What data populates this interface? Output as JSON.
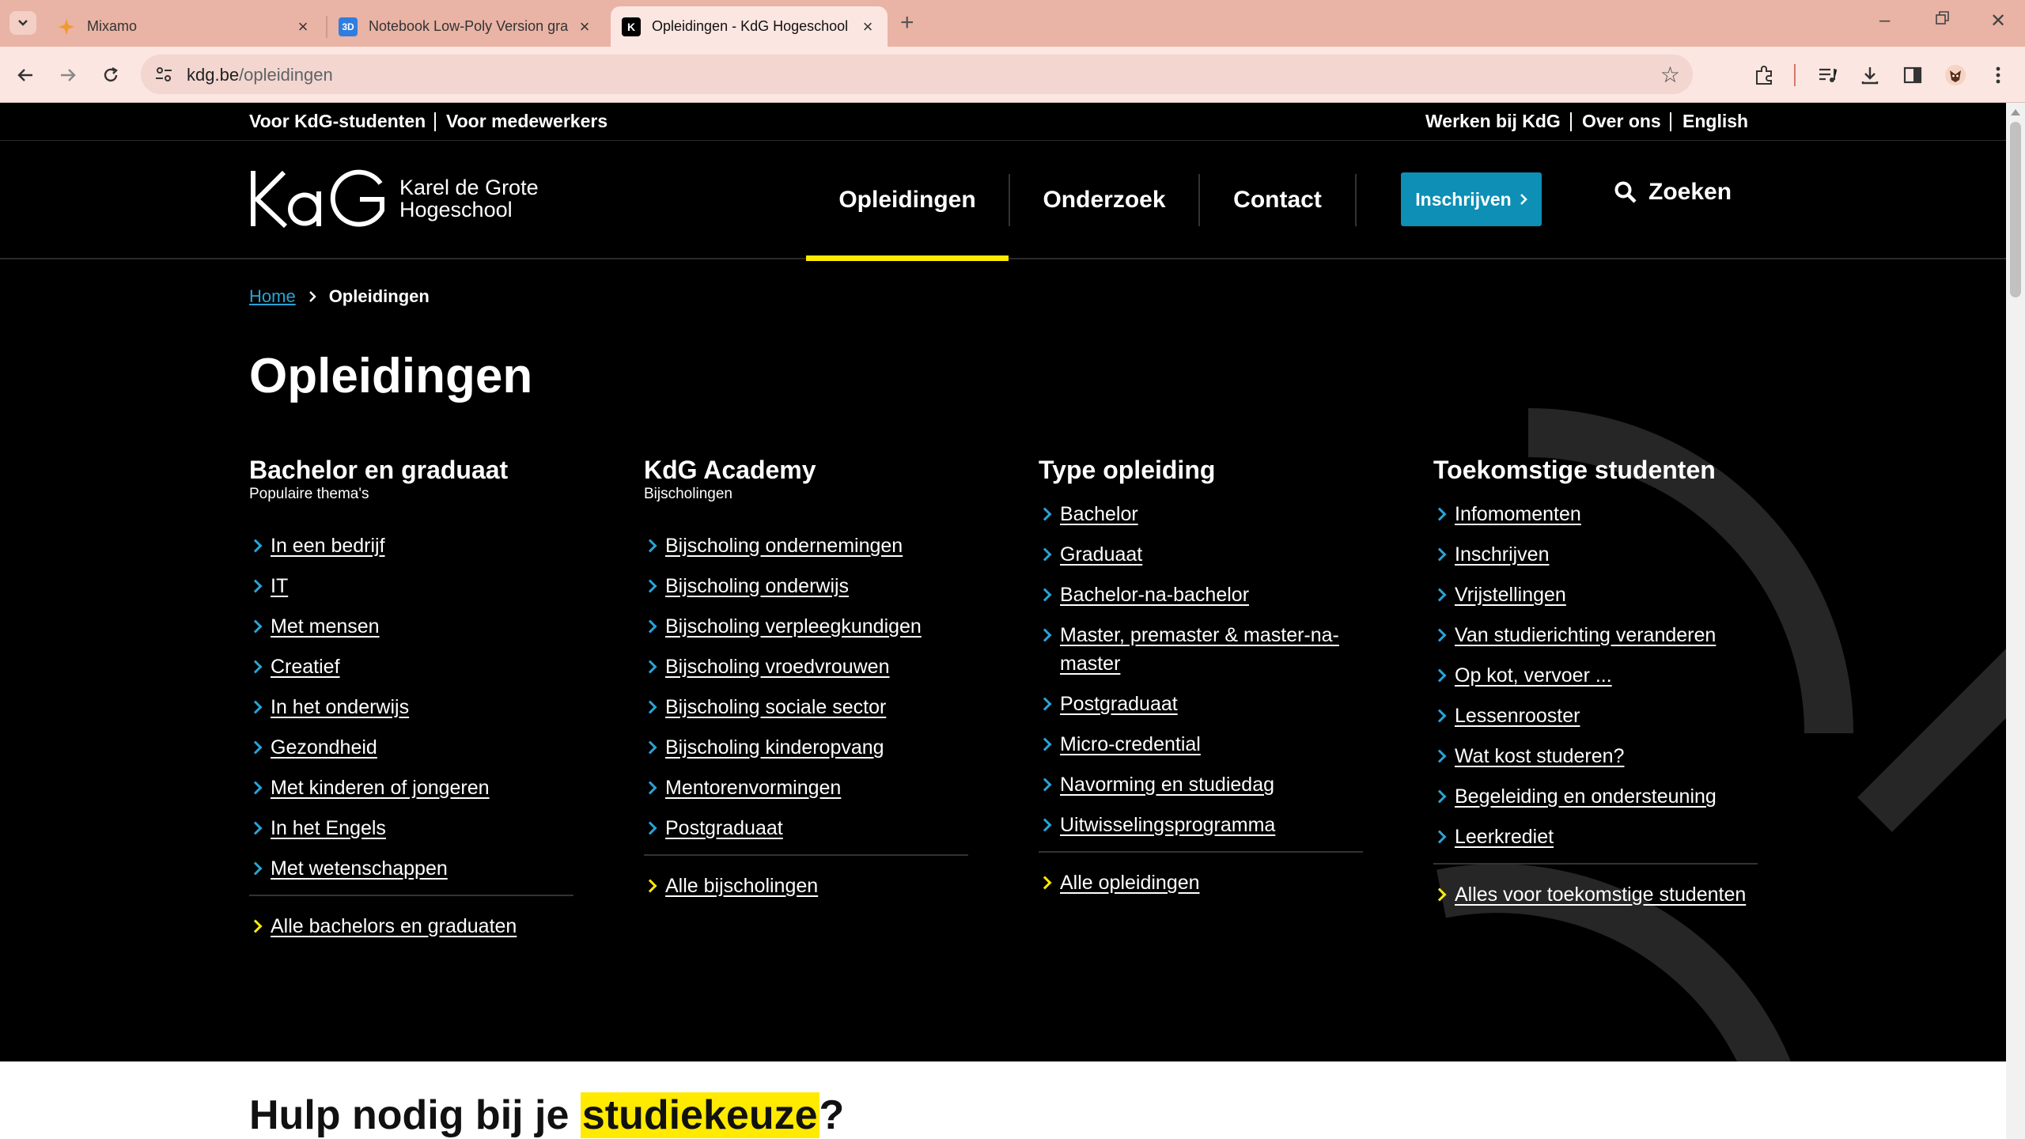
{
  "browser": {
    "tabs": [
      {
        "title": "Mixamo",
        "icon": "mixamo-icon"
      },
      {
        "title": "Notebook Low-Poly Version gra",
        "icon": "3d-icon"
      },
      {
        "title": "Opleidingen - KdG Hogeschool",
        "icon": "kdg-icon"
      }
    ],
    "url_domain": "kdg.be",
    "url_path": "/opleidingen"
  },
  "site": {
    "util_left": [
      "Voor KdG-studenten",
      "Voor medewerkers"
    ],
    "util_right": [
      "Werken bij KdG",
      "Over ons",
      "English"
    ],
    "logo_line1": "Karel de Grote",
    "logo_line2": "Hogeschool",
    "nav": [
      "Opleidingen",
      "Onderzoek",
      "Contact"
    ],
    "cta": "Inschrijven",
    "search": "Zoeken",
    "breadcrumb_home": "Home",
    "breadcrumb_current": "Opleidingen",
    "title": "Opleidingen",
    "columns": [
      {
        "title": "Bachelor en graduaat",
        "subtitle": "Populaire thema's",
        "links": [
          "In een bedrijf",
          "IT",
          "Met mensen",
          "Creatief",
          "In het onderwijs",
          "Gezondheid",
          "Met kinderen of jongeren",
          "In het Engels",
          "Met wetenschappen"
        ],
        "all": "Alle bachelors en graduaten"
      },
      {
        "title": "KdG Academy",
        "subtitle": "Bijscholingen",
        "links": [
          "Bijscholing ondernemingen",
          "Bijscholing onderwijs",
          "Bijscholing verpleegkundigen",
          "Bijscholing vroedvrouwen",
          "Bijscholing sociale sector",
          "Bijscholing kinderopvang",
          "Mentorenvormingen",
          "Postgraduaat"
        ],
        "all": "Alle bijscholingen"
      },
      {
        "title": "Type opleiding",
        "subtitle": "",
        "links": [
          "Bachelor",
          "Graduaat",
          "Bachelor-na-bachelor",
          "Master, premaster & master-na-master",
          "Postgraduaat",
          "Micro-credential",
          "Navorming en studiedag",
          "Uitwisselingsprogramma"
        ],
        "all": "Alle opleidingen"
      },
      {
        "title": "Toekomstige studenten",
        "subtitle": "",
        "links": [
          "Infomomenten",
          "Inschrijven",
          "Vrijstellingen",
          "Van studierichting veranderen",
          "Op kot, vervoer ...",
          "Lessenrooster",
          "Wat kost studeren?",
          "Begeleiding en ondersteuning",
          "Leerkrediet"
        ],
        "all": "Alles voor toekomstige studenten"
      }
    ],
    "help_prefix": "Hulp nodig bij je ",
    "help_highlight": "studiekeuze",
    "help_suffix": "?"
  },
  "colors": {
    "accent_yellow": "#ffea00",
    "accent_blue": "#0d8fb6",
    "link_blue": "#29a3d6"
  }
}
